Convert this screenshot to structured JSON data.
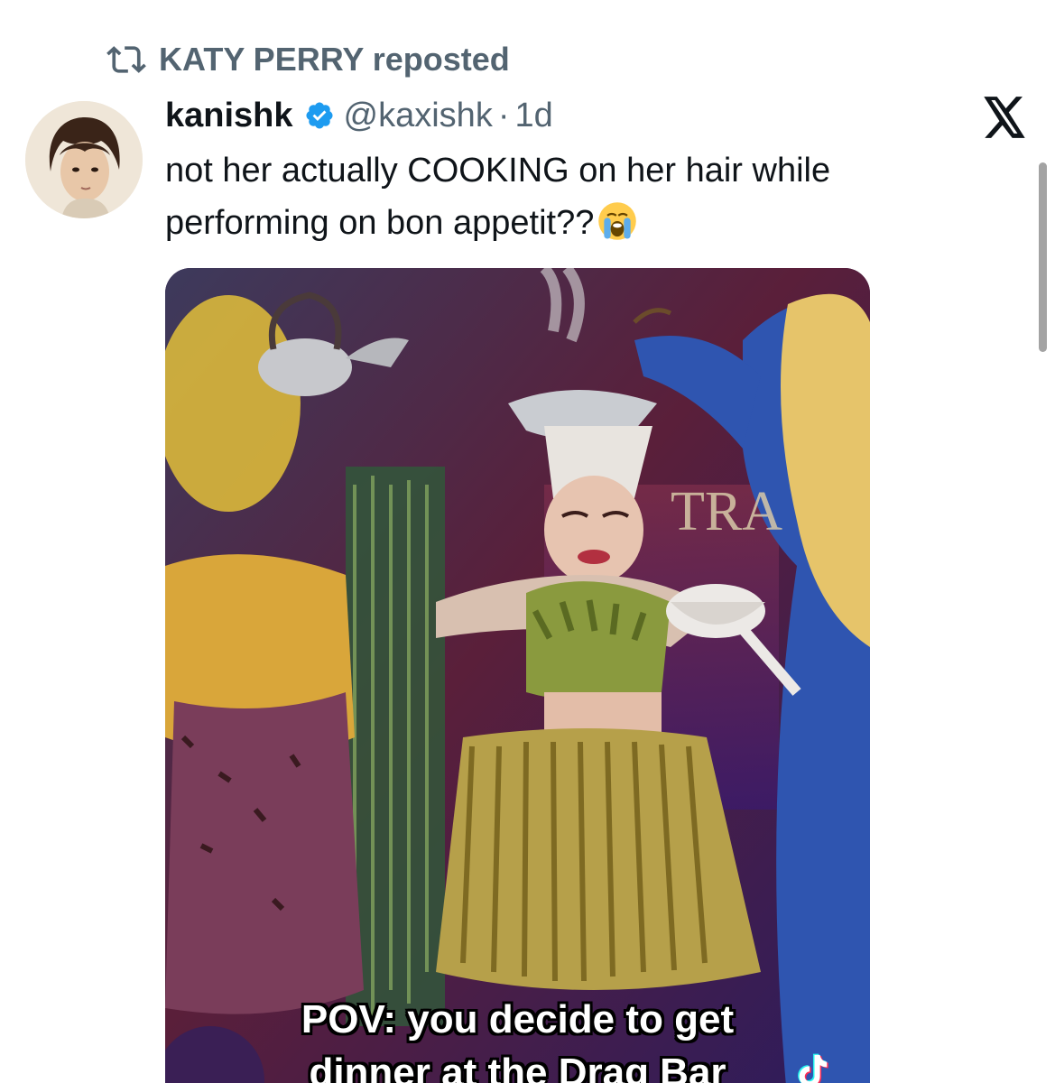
{
  "repost": {
    "label": "KATY PERRY reposted",
    "icon": "repost-icon"
  },
  "tweet": {
    "author_name": "kanishk",
    "verified": true,
    "verified_color": "#1d9bf0",
    "handle": "@kaxishk",
    "separator": "·",
    "time": "1d",
    "text": "not her actually COOKING on her hair while performing on bon appetit??",
    "emoji": "loudly-crying-face-icon"
  },
  "media": {
    "caption_line_1": "POV: you decide to get",
    "caption_line_2": "dinner at the Drag Bar",
    "sign_text": "TRA",
    "watermark": "tiktok-icon"
  },
  "app": {
    "logo": "x-logo-icon"
  },
  "colors": {
    "text_primary": "#0f1419",
    "text_secondary": "#536471",
    "accent_verified": "#1d9bf0"
  }
}
